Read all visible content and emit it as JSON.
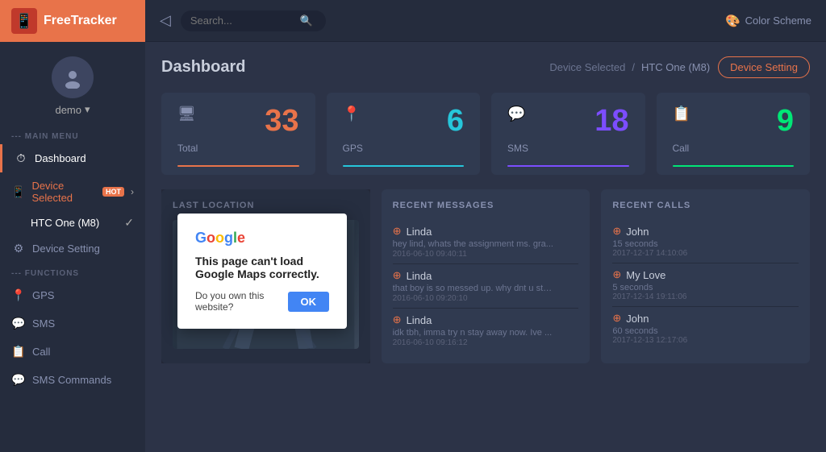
{
  "app": {
    "name": "FreeTracker",
    "logo_emoji": "📱"
  },
  "topbar": {
    "search_placeholder": "Search...",
    "color_scheme_label": "Color Scheme"
  },
  "sidebar": {
    "profile_name": "demo",
    "main_menu_label": "--- MAIN MENU",
    "items": [
      {
        "id": "dashboard",
        "label": "Dashboard",
        "icon": "⏱",
        "active": true
      },
      {
        "id": "device-selected",
        "label": "Device Selected",
        "icon": "📱",
        "hot": true
      },
      {
        "id": "htc-one",
        "label": "HTC One (M8)",
        "sub": true
      },
      {
        "id": "device-setting",
        "label": "Device Setting",
        "icon": "⚙"
      }
    ],
    "functions_label": "--- FUNCTIONS",
    "function_items": [
      {
        "id": "gps",
        "label": "GPS",
        "icon": "📍"
      },
      {
        "id": "sms",
        "label": "SMS",
        "icon": "💬"
      },
      {
        "id": "call",
        "label": "Call",
        "icon": "📋"
      },
      {
        "id": "sms-commands",
        "label": "SMS Commands",
        "icon": "💬"
      }
    ]
  },
  "page": {
    "title": "Dashboard",
    "breadcrumb_label": "Device Selected",
    "breadcrumb_sep": "/",
    "breadcrumb_device": "HTC One (M8)",
    "device_setting_btn": "Device Setting"
  },
  "stats": [
    {
      "id": "total",
      "label": "Total",
      "value": "33",
      "color": "#e8734a",
      "bar_color": "#e8734a",
      "icon": "🖥"
    },
    {
      "id": "gps",
      "label": "GPS",
      "value": "6",
      "color": "#26c6da",
      "bar_color": "#26c6da",
      "icon": "📍"
    },
    {
      "id": "sms",
      "label": "SMS",
      "value": "18",
      "color": "#7c4dff",
      "bar_color": "#7c4dff",
      "icon": "💬"
    },
    {
      "id": "call",
      "label": "Call",
      "value": "9",
      "color": "#00e676",
      "bar_color": "#00e676",
      "icon": "📋"
    }
  ],
  "last_location": {
    "title": "LAST LOCATION"
  },
  "google_dialog": {
    "logo_text": "Google",
    "title": "This page can't load Google Maps correctly.",
    "question": "Do you own this website?",
    "ok_label": "OK"
  },
  "recent_messages": {
    "title": "RECENT MESSAGES",
    "items": [
      {
        "sender": "Linda",
        "text": "hey lind, whats the assignment ms. gra...",
        "time": "2016-06-10 09:40:11"
      },
      {
        "sender": "Linda",
        "text": "that boy is so messed up. why dnt u sta...",
        "time": "2016-06-10 09:20:10"
      },
      {
        "sender": "Linda",
        "text": "idk tbh, imma try n stay away now. Ive ...",
        "time": "2016-06-10 09:16:12"
      }
    ]
  },
  "recent_calls": {
    "title": "RECENT CALLS",
    "items": [
      {
        "name": "John",
        "duration": "15 seconds",
        "time": "2017-12-17 14:10:06"
      },
      {
        "name": "My Love",
        "duration": "5 seconds",
        "time": "2017-12-14 19:11:06"
      },
      {
        "name": "John",
        "duration": "60 seconds",
        "time": "2017-12-13 12:17:06"
      }
    ]
  }
}
